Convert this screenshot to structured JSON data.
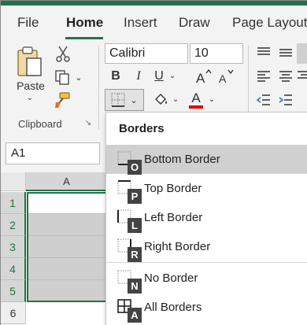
{
  "tabs": [
    "File",
    "Home",
    "Insert",
    "Draw",
    "Page Layout"
  ],
  "ribbon": {
    "paste_label": "Paste",
    "font_name": "Calibri",
    "font_size": "10",
    "clipboard_label": "Clipboard",
    "bold": "B",
    "italic": "I",
    "underline": "U",
    "font_color_glyph": "A"
  },
  "namebox": {
    "value": "A1"
  },
  "grid": {
    "column": "A",
    "rows": [
      "1",
      "2",
      "3",
      "4",
      "5",
      "6"
    ]
  },
  "menu": {
    "title": "Borders",
    "items": [
      {
        "label": "Bottom Border",
        "keytip": "O",
        "icon": "bottom-border-icon"
      },
      {
        "label": "Top Border",
        "keytip": "P",
        "icon": "top-border-icon"
      },
      {
        "label": "Left Border",
        "keytip": "L",
        "icon": "left-border-icon"
      },
      {
        "label": "Right Border",
        "keytip": "R",
        "icon": "right-border-icon"
      },
      {
        "label": "No Border",
        "keytip": "N",
        "icon": "no-border-icon"
      },
      {
        "label": "All Borders",
        "keytip": "A",
        "icon": "all-borders-icon"
      }
    ]
  },
  "colors": {
    "accent": "#217346",
    "font_color_bar": "#e00000"
  }
}
